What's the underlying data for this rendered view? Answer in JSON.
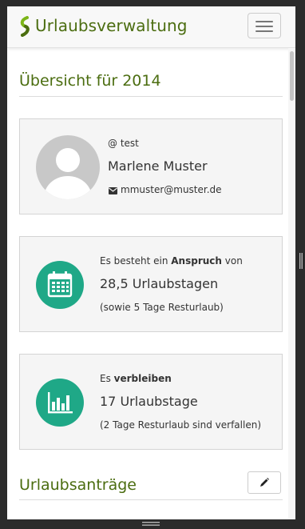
{
  "app": {
    "title": "Urlaubsverwaltung"
  },
  "overview": {
    "title": "Übersicht für 2014"
  },
  "user": {
    "login": "@ test",
    "name": "Marlene Muster",
    "email": "mmuster@muster.de"
  },
  "entitlement": {
    "prefix": "Es besteht ein ",
    "keyword": "Anspruch",
    "suffix": " von",
    "days": "28,5 Urlaubstagen",
    "note": "(sowie 5 Tage Resturlaub)"
  },
  "remaining": {
    "prefix": "Es ",
    "keyword": "verbleiben",
    "days": "17 Urlaubstage",
    "note": "(2 Tage Resturlaub sind verfallen)"
  },
  "requests": {
    "title": "Urlaubsanträge"
  },
  "colors": {
    "brand": "#4b6d10",
    "accent": "#1fa887",
    "card_bg": "#f5f5f5"
  },
  "icons": [
    "brand-logo-icon",
    "menu-icon",
    "avatar-icon",
    "envelope-icon",
    "calendar-icon",
    "bar-chart-icon",
    "pencil-icon"
  ]
}
